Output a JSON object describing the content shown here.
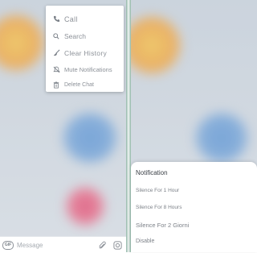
{
  "chat_menu": {
    "items": [
      {
        "label": "Call",
        "icon": "phone-icon"
      },
      {
        "label": "Search",
        "icon": "search-icon"
      },
      {
        "label": "Clear History",
        "icon": "broom-icon"
      },
      {
        "label": "Mute Notifications",
        "icon": "bell-off-icon"
      },
      {
        "label": "Delete Chat",
        "icon": "trash-icon"
      }
    ]
  },
  "composer": {
    "gif_label": "GIF",
    "placeholder": "Message"
  },
  "notification_sheet": {
    "title": "Notification",
    "options": [
      "Silence For 1 Hour",
      "Silence For 8 Hours",
      "Silence For 2 Giorni",
      "Disable"
    ]
  },
  "colors": {
    "menu_text": "#8c9198",
    "sheet_title": "#3b4047",
    "divider": "#8fb6a6"
  }
}
